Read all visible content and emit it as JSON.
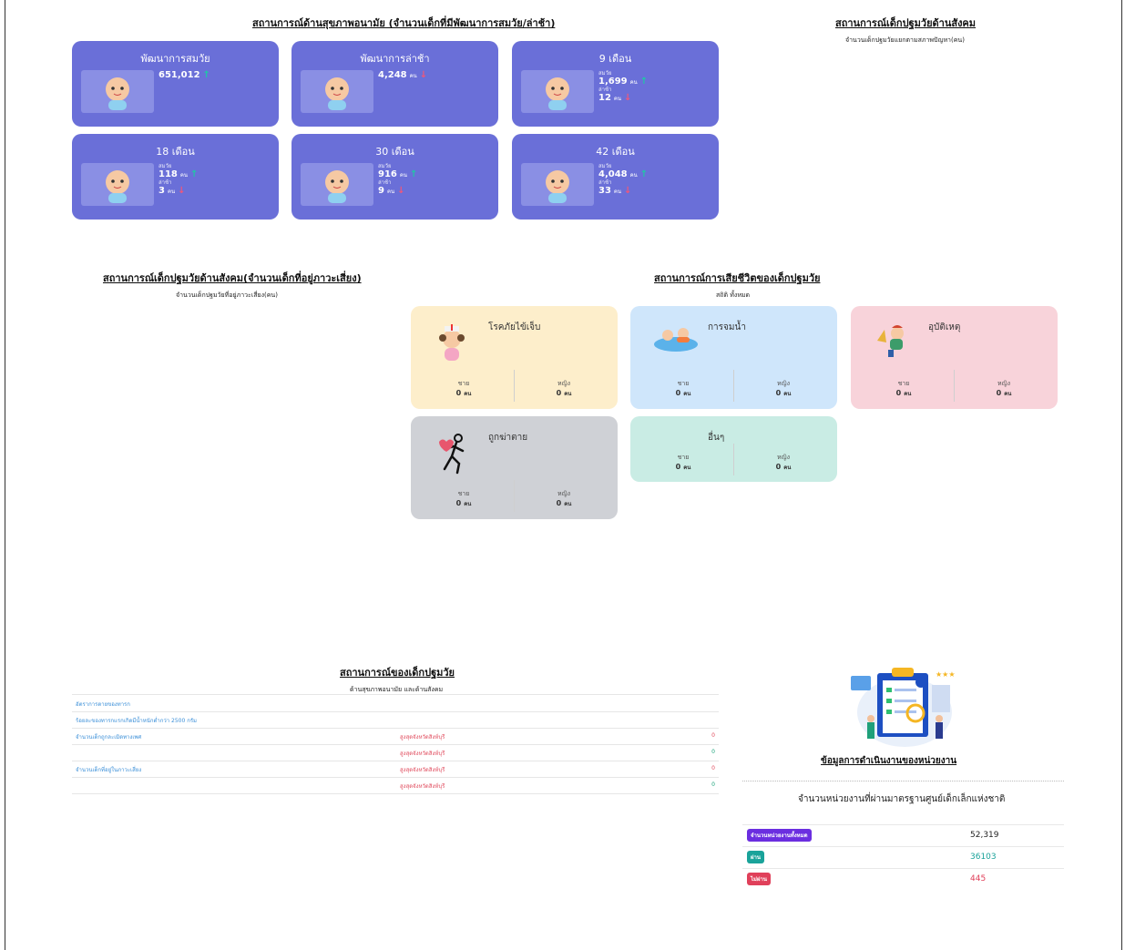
{
  "health": {
    "title": "สถานการณ์ด้านสุขภาพอนามัย (จำนวนเด็กที่มีพัฒนาการสมวัย/ล่าช้า)",
    "cards": [
      {
        "title": "พัฒนาการสมวัย",
        "value": "651,012",
        "trend": "up"
      },
      {
        "title": "พัฒนาการล่าช้า",
        "value": "4,248",
        "unit": "คน",
        "trend": "down"
      },
      {
        "title": "9 เดือน",
        "label1": "สมวัย",
        "value1": "1,699",
        "unit1": "คน",
        "label2": "ล่าช้า",
        "value2": "12",
        "unit2": "คน"
      },
      {
        "title": "18 เดือน",
        "label1": "สมวัย",
        "value1": "118",
        "unit1": "คน",
        "label2": "ล่าช้า",
        "value2": "3",
        "unit2": "คน"
      },
      {
        "title": "30 เดือน",
        "label1": "สมวัย",
        "value1": "916",
        "unit1": "คน",
        "label2": "ล่าช้า",
        "value2": "9",
        "unit2": "คน"
      },
      {
        "title": "42 เดือน",
        "label1": "สมวัย",
        "value1": "4,048",
        "unit1": "คน",
        "label2": "ล่าช้า",
        "value2": "33",
        "unit2": "คน"
      }
    ]
  },
  "social": {
    "title": "สถานการณ์เด็กปฐมวัยด้านสังคม",
    "subtitle": "จำนวนเด็กปฐมวัยแยกตามสภาพปัญหา(คน)"
  },
  "risk": {
    "title": "สถานการณ์เด็กปฐมวัยด้านสังคม(จำนวนเด็กที่อยู่ภาวะเสี่ยง)",
    "subtitle": "จำนวนเด็กปฐมวัยที่อยู่ภาวะเสี่ยง(คน)"
  },
  "death": {
    "title": "สถานการณ์การเสียชีวิตของเด็กปฐมวัย",
    "subtitle": "สถิติ ทั้งหมด",
    "male_label": "ชาย",
    "female_label": "หญิง",
    "cards": [
      {
        "title": "โรคภัยไข้เจ็บ",
        "male": "0",
        "female": "0",
        "unit": "คน",
        "color": "#fdeecb"
      },
      {
        "title": "การจมน้ำ",
        "male": "0",
        "female": "0",
        "unit": "คน",
        "color": "#cfe6fb"
      },
      {
        "title": "อุบัติเหตุ",
        "male": "0",
        "female": "0",
        "unit": "คน",
        "color": "#f8d3da"
      },
      {
        "title": "ถูกฆ่าตาย",
        "male": "0",
        "female": "0",
        "unit": "คน",
        "color": "#cfd1d6"
      },
      {
        "title": "อื่นๆ",
        "male": "0",
        "female": "0",
        "unit": "คน",
        "color": "#c9ece4"
      }
    ]
  },
  "situation": {
    "title": "สถานการณ์ของเด็กปฐมวัย",
    "subtitle": "ด้านสุขภาพอนามัย และด้านสังคม",
    "rows": [
      {
        "label": "อัตราการตายของทารก",
        "place": "",
        "value": ""
      },
      {
        "label": "ร้อยละของทารกแรกเกิดมีน้ำหนักต่ำกว่า 2500 กรัม",
        "place": "",
        "value": ""
      },
      {
        "label": "จำนวนเด็กถูกละเมิดทางเพศ",
        "place": "สูงสุดจังหวัดสิงห์บุรี",
        "value": "0",
        "vcolor": "#e04a5c"
      },
      {
        "label": "",
        "place": "สูงสุดจังหวัดสิงห์บุรี",
        "value": "0",
        "vcolor": "#1aa37a"
      },
      {
        "label": "จำนวนเด็กที่อยู่ในภาวะเสี่ยง",
        "place": "สูงสุดจังหวัดสิงห์บุรี",
        "value": "0",
        "vcolor": "#e04a5c"
      },
      {
        "label": "",
        "place": "สูงสุดจังหวัดสิงห์บุรี",
        "value": "0",
        "vcolor": "#1aa37a"
      }
    ]
  },
  "agency": {
    "title": "ข้อมูลการดำเนินงานของหน่วยงาน",
    "standard_title": "จำนวนหน่วยงานที่ผ่านมาตรฐานศูนย์เด็กเล็กแห่งชาติ",
    "stats": [
      {
        "label": "จำนวนหน่วยงานทั้งหมด",
        "value": "52,319",
        "color": "#6b2ee0",
        "vcolor": "#222222"
      },
      {
        "label": "ผ่าน",
        "value": "36103",
        "color": "#1aa39a",
        "vcolor": "#1aa39a"
      },
      {
        "label": "ไม่ผ่าน",
        "value": "445",
        "color": "#e0405a",
        "vcolor": "#e0405a"
      }
    ]
  }
}
